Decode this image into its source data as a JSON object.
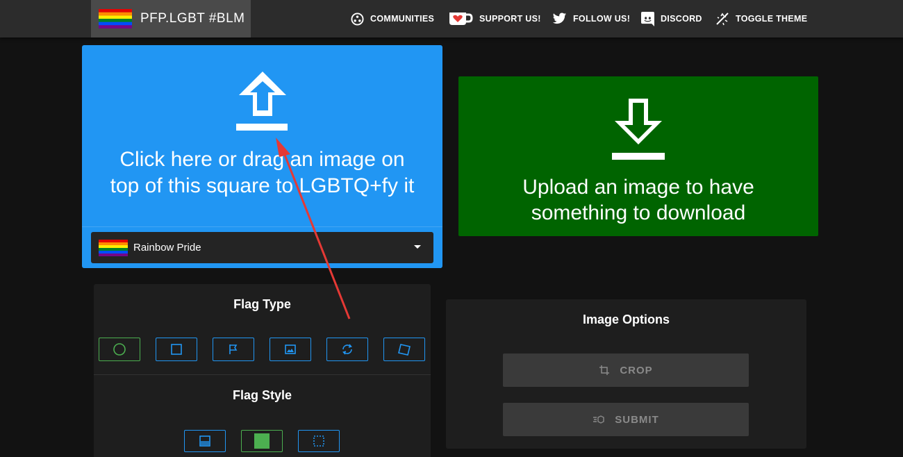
{
  "header": {
    "brand": "PFP.LGBT #BLM",
    "nav": [
      {
        "label": "COMMUNITIES",
        "icon": "communities-icon"
      },
      {
        "label": "SUPPORT US!",
        "icon": "kofi-heart-icon"
      },
      {
        "label": "FOLLOW US!",
        "icon": "twitter-icon"
      },
      {
        "label": "DISCORD",
        "icon": "discord-icon"
      },
      {
        "label": "TOGGLE THEME",
        "icon": "theme-toggle-icon"
      }
    ]
  },
  "upload": {
    "line1": "Click here or drag an image on",
    "line2": "top of this square to LGBTQ+fy it",
    "flag_select": "Rainbow Pride"
  },
  "download": {
    "line1": "Upload an image to have",
    "line2": "something to download"
  },
  "flag_type": {
    "title": "Flag Type",
    "options": [
      "circle-icon",
      "square-icon",
      "flag-icon",
      "image-icon",
      "rotate-icon",
      "tilted-square-icon"
    ]
  },
  "flag_style": {
    "title": "Flag Style",
    "options": [
      "gradient-icon",
      "solid-fill-icon",
      "dotted-outline-icon"
    ]
  },
  "image_options": {
    "title": "Image Options",
    "crop": "CROP",
    "submit": "SUBMIT"
  },
  "colors": {
    "upload_bg": "#2196f3",
    "download_bg": "#006400",
    "selected_border": "#4caf50",
    "option_border": "#2196f3",
    "annotation_arrow": "#e53935"
  }
}
